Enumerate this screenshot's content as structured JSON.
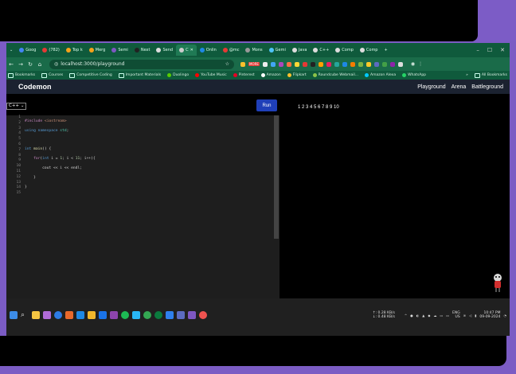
{
  "browser": {
    "tabs": [
      "Goog",
      "(782)",
      "Top k",
      "Merg",
      "Semi",
      "Next",
      "Send",
      "C",
      "Onlin",
      "@mc",
      "Mons",
      "Gemi",
      "Java",
      "C++",
      "Comp",
      "Comp"
    ],
    "new_tab": "+",
    "window_controls": [
      "–",
      "☐",
      "✕"
    ],
    "address": "localhost:3000/playground",
    "extensions_badge": "MORE"
  },
  "bookmarks": [
    "Bookmarks",
    "Courses",
    "Competitive Coding",
    "Important Materials",
    "Duolingo",
    "YouTube Music",
    "Pinterest",
    "Amazon",
    "Flipkart",
    "Roundcube Webmail...",
    "Amazon Alexa",
    "WhatsApp",
    "»",
    "All Bookmarks"
  ],
  "app": {
    "brand": "Codemon",
    "nav": [
      "Playground",
      "Arena",
      "Battleground"
    ]
  },
  "playground": {
    "language": "C++",
    "run_label": "Run",
    "output": "1 2 3 4 5 6 7 8 9 10",
    "line_numbers": [
      "1",
      "2",
      "3",
      "4",
      "5",
      "6",
      "7",
      "8",
      "9",
      "10",
      "11",
      "12",
      "13",
      "14",
      "15"
    ]
  },
  "taskbar": {
    "net_up": "↑: 0.28 KB/s",
    "net_down": "↓: 0.48 KB/s",
    "lang_top": "ENG",
    "lang_bottom": "US",
    "time": "10:47 PM",
    "date": "09-09-2024"
  },
  "colors": {
    "tab_bar": "#0f5a3c",
    "app_header": "#1b2230",
    "run_button": "#1f3fb8",
    "editor_bg": "#1e1e1e",
    "frame": "#7c5cc6"
  }
}
